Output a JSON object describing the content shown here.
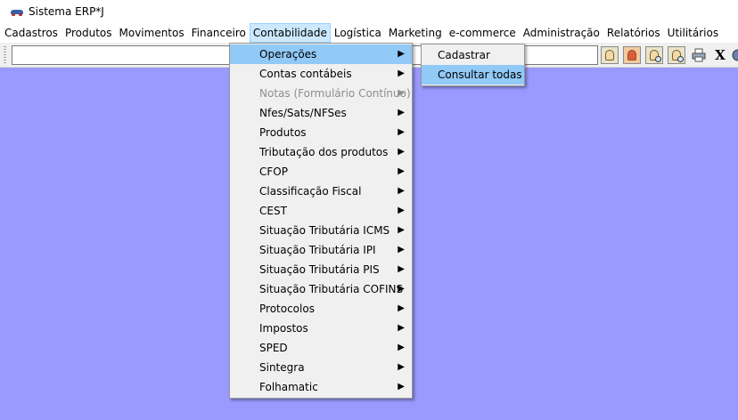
{
  "window": {
    "title": "Sistema ERP*J"
  },
  "menubar": {
    "items": [
      {
        "label": "Cadastros"
      },
      {
        "label": "Produtos"
      },
      {
        "label": "Movimentos"
      },
      {
        "label": "Financeiro"
      },
      {
        "label": "Contabilidade",
        "active": true
      },
      {
        "label": "Logística"
      },
      {
        "label": "Marketing"
      },
      {
        "label": "e-commerce"
      },
      {
        "label": "Administração"
      },
      {
        "label": "Relatórios"
      },
      {
        "label": "Utilitários"
      }
    ]
  },
  "toolbar": {
    "search_value": "",
    "close_label": "X"
  },
  "contabilidade_menu": {
    "items": [
      {
        "label": "Operações",
        "highlighted": true
      },
      {
        "label": "Contas contábeis"
      },
      {
        "label": "Notas (Formulário Contínuo)",
        "disabled": true
      },
      {
        "label": "Nfes/Sats/NFSes"
      },
      {
        "label": "Produtos"
      },
      {
        "label": "Tributação dos produtos"
      },
      {
        "label": "CFOP"
      },
      {
        "label": "Classificação Fiscal"
      },
      {
        "label": "CEST"
      },
      {
        "label": "Situação Tributária ICMS"
      },
      {
        "label": "Situação Tributária IPI"
      },
      {
        "label": "Situação Tributária PIS"
      },
      {
        "label": "Situação Tributária COFINS"
      },
      {
        "label": "Protocolos"
      },
      {
        "label": "Impostos"
      },
      {
        "label": "SPED"
      },
      {
        "label": "Sintegra"
      },
      {
        "label": "Folhamatic"
      }
    ]
  },
  "operacoes_submenu": {
    "items": [
      {
        "label": "Cadastrar"
      },
      {
        "label": "Consultar todas",
        "highlighted": true
      }
    ]
  },
  "colors": {
    "desktop": "#9999ff",
    "menu_highlight": "#91c9f7",
    "menubar_active": "#cce8ff"
  }
}
